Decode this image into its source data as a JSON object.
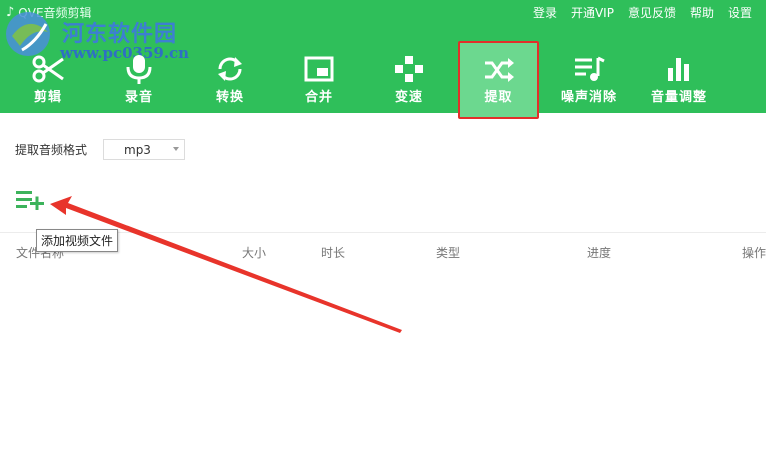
{
  "app": {
    "title": "QVE音频剪辑"
  },
  "watermark": {
    "name": "河东软件园",
    "url": "www.pc0359.cn"
  },
  "top_links": [
    "登录",
    "开通VIP",
    "意见反馈",
    "帮助",
    "设置"
  ],
  "tools": [
    {
      "label": "剪辑",
      "icon": "scissors-icon"
    },
    {
      "label": "录音",
      "icon": "microphone-icon"
    },
    {
      "label": "转换",
      "icon": "convert-icon"
    },
    {
      "label": "合并",
      "icon": "merge-icon"
    },
    {
      "label": "变速",
      "icon": "speed-icon"
    },
    {
      "label": "提取",
      "icon": "shuffle-icon",
      "active": true
    },
    {
      "label": "噪声消除",
      "icon": "noise-icon"
    },
    {
      "label": "音量调整",
      "icon": "volume-bars-icon"
    }
  ],
  "format": {
    "label": "提取音频格式",
    "value": "mp3"
  },
  "add_tooltip": "添加视频文件",
  "table": {
    "headers": [
      "文件名称",
      "大小",
      "时长",
      "类型",
      "进度",
      "操作"
    ]
  },
  "colors": {
    "header_green": "#2fbf5a",
    "active_bg": "#6cd88f",
    "highlight_red": "#e2302a"
  }
}
